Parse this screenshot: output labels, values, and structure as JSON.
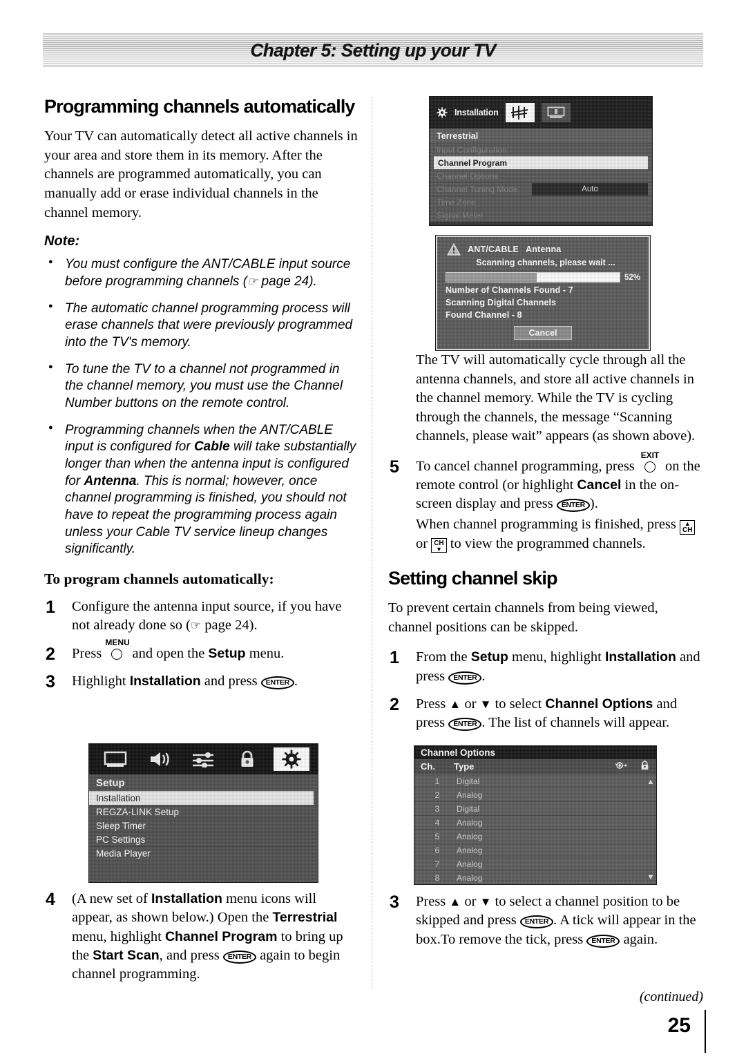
{
  "banner": {
    "title": "Chapter 5: Setting up your TV"
  },
  "left": {
    "heading": "Programming channels automatically",
    "intro": "Your TV can automatically detect all active channels in your area and store them in its memory. After the channels are programmed automatically, you can manually add or erase individual channels in the channel memory.",
    "note_label": "Note:",
    "notes": [
      {
        "pre": "You must configure the ANT/CABLE input source before programming channels (",
        "hand": "☞",
        "post": " page 24)."
      },
      {
        "pre": "The automatic channel programming process will erase channels that were previously programmed into the TV's memory."
      },
      {
        "pre": "To tune the TV to a channel not programmed in the channel memory, you must use the Channel Number buttons on the remote control."
      },
      {
        "pre": "Programming channels when the ANT/CABLE input is configured for ",
        "b1": "Cable",
        "mid": " will take substantially longer than when the antenna input is configured for ",
        "b2": "Antenna",
        "post": ". This is normal; however, once channel programming is finished, you should not have to repeat the programming process again unless your Cable TV service lineup changes significantly."
      }
    ],
    "subheading": "To program channels automatically:",
    "steps": [
      {
        "num": "1",
        "pre": "Configure the antenna input source, if you have not already done so (",
        "hand": "☞",
        "post": " page 24)."
      },
      {
        "num": "2",
        "pre": "Press ",
        "key": "MENU",
        "mid": " and open the ",
        "bold": "Setup",
        "post": " menu."
      },
      {
        "num": "3",
        "pre": "Highlight ",
        "bold": "Installation",
        "mid": " and press ",
        "enter": "ENTER",
        "post": "."
      },
      {
        "num": "4",
        "pre": "(A new set of ",
        "b1": "Installation",
        "t1": " menu icons will appear, as shown below.) Open the ",
        "b2": "Terrestrial",
        "t2": " menu, highlight ",
        "b3": "Channel Program",
        "t3": " to bring up the ",
        "b4": "Start Scan",
        "t4": ", and press ",
        "enter": "ENTER",
        "t5": " again to begin channel programming."
      }
    ]
  },
  "right": {
    "cycle_text": "The TV will automatically cycle through all the antenna channels, and store all active channels in the channel memory. While the TV is cycling through the channels, the message “Scanning channels, please wait” appears (as shown above).",
    "step5": {
      "num": "5",
      "pre": "To cancel channel programming, press ",
      "key": "EXIT",
      "mid": " on the remote control (or highlight ",
      "bold": "Cancel",
      "mid2": " in the on-screen display and press ",
      "enter": "ENTER",
      "post": ").",
      "line2_pre": "When channel programming is finished, press ",
      "ch_up": "CH",
      "line2_mid": " or ",
      "ch_down": "CH",
      "line2_post": " to view the programmed channels."
    },
    "heading2": "Setting channel skip",
    "intro2": "To prevent certain channels from being viewed, channel positions can be skipped.",
    "steps2": [
      {
        "num": "1",
        "pre": "From the ",
        "b1": "Setup",
        "t1": " menu, highlight ",
        "b2": "Installation",
        "t2": " and press ",
        "enter": "ENTER",
        "post": "."
      },
      {
        "num": "2",
        "pre": "Press ",
        "up": "▲",
        "mid": " or ",
        "down": "▼",
        "mid2": " to select ",
        "bold": "Channel Options",
        "mid3": " and press ",
        "enter": "ENTER",
        "post": ". The list of channels will appear."
      },
      {
        "num": "3",
        "pre": "Press ",
        "up": "▲",
        "mid": " or ",
        "down": "▼",
        "mid2": " to select a channel position to be skipped and press ",
        "enter": "ENTER",
        "mid3": ". A tick will appear in the box.To remove the tick, press ",
        "enter2": "ENTER",
        "post": " again."
      }
    ]
  },
  "install_menu": {
    "title": "Installation",
    "header": "Terrestrial",
    "rows": [
      {
        "label": "Input Configuration",
        "state": "dimmed",
        "value": ""
      },
      {
        "label": "Channel Program",
        "state": "highlighted",
        "value": ""
      },
      {
        "label": "Channel Options",
        "state": "dimmed",
        "value": ""
      },
      {
        "label": "Channel Tuning Mode",
        "state": "dimmed",
        "value": "Auto"
      },
      {
        "label": "Time Zone",
        "state": "dimmed",
        "value": ""
      },
      {
        "label": "Signal Meter",
        "state": "dimmed",
        "value": ""
      }
    ]
  },
  "scan_dialog": {
    "source_label": "ANT/CABLE",
    "source_value": "Antenna",
    "wait_message": "Scanning channels, please wait ...",
    "progress_percent": "52%",
    "progress_value": 52,
    "channels_found": "Number of Channels Found - 7",
    "scanning_line": "Scanning Digital Channels",
    "found_channel": "Found Channel - 8",
    "cancel_label": "Cancel"
  },
  "setup_menu": {
    "title": "Setup",
    "icons": [
      "picture-icon",
      "audio-icon",
      "sliders-icon",
      "lock-icon",
      "gear-icon"
    ],
    "selected_icon": "gear-icon",
    "rows": [
      {
        "label": "Installation",
        "state": "highlighted"
      },
      {
        "label": "REGZA-LINK Setup",
        "state": "normal"
      },
      {
        "label": "Sleep Timer",
        "state": "normal"
      },
      {
        "label": "PC Settings",
        "state": "normal"
      },
      {
        "label": "Media Player",
        "state": "normal"
      }
    ]
  },
  "channel_options": {
    "title": "Channel Options",
    "columns": [
      "Ch.",
      "Type",
      "skip-eye-icon",
      "lock-icon"
    ],
    "rows": [
      {
        "ch": "1",
        "type": "Digital",
        "skip": false,
        "lock": false,
        "focused": true
      },
      {
        "ch": "2",
        "type": "Analog",
        "skip": false,
        "lock": false,
        "focused": false
      },
      {
        "ch": "3",
        "type": "Digital",
        "skip": false,
        "lock": false,
        "focused": false
      },
      {
        "ch": "4",
        "type": "Analog",
        "skip": false,
        "lock": false,
        "focused": false
      },
      {
        "ch": "5",
        "type": "Analog",
        "skip": false,
        "lock": false,
        "focused": false
      },
      {
        "ch": "6",
        "type": "Analog",
        "skip": false,
        "lock": false,
        "focused": false
      },
      {
        "ch": "7",
        "type": "Analog",
        "skip": false,
        "lock": false,
        "focused": false
      },
      {
        "ch": "8",
        "type": "Analog",
        "skip": false,
        "lock": false,
        "focused": false
      }
    ],
    "scroll_up": "▲",
    "scroll_down": "▼"
  },
  "footer": {
    "continued": "(continued)",
    "page_number": "25"
  }
}
